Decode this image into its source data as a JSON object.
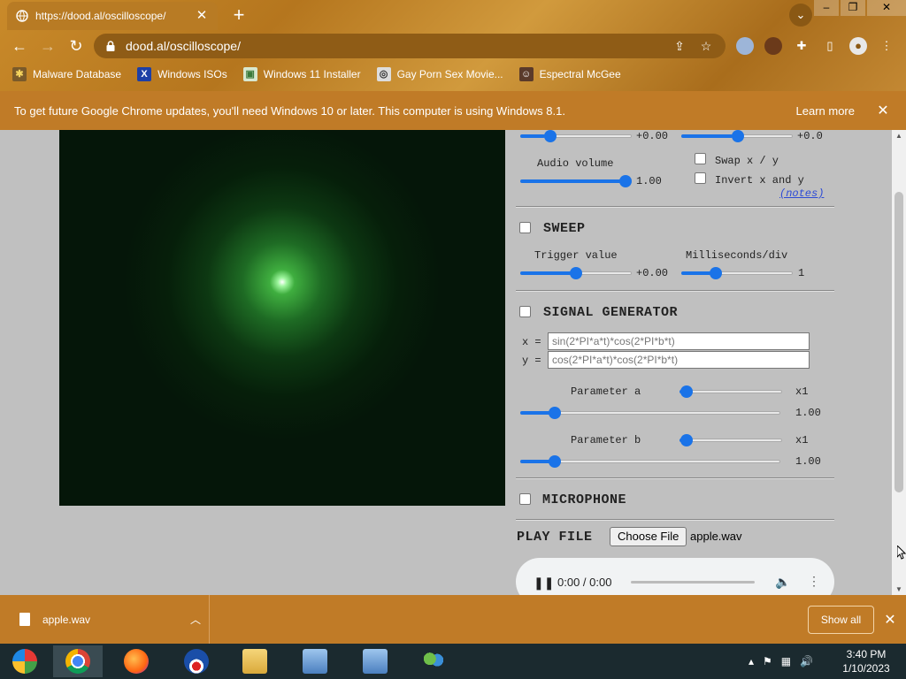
{
  "browser": {
    "tab_title": "https://dood.al/oscilloscope/",
    "url": "dood.al/oscilloscope/",
    "bookmarks": [
      {
        "label": "Malware Database",
        "icon": "bug-icon"
      },
      {
        "label": "Windows ISOs",
        "icon": "x-logo-icon"
      },
      {
        "label": "Windows 11 Installer",
        "icon": "image-icon"
      },
      {
        "label": "Gay Porn Sex Movie...",
        "icon": "globe-icon"
      },
      {
        "label": "Espectral McGee",
        "icon": "person-icon"
      }
    ],
    "infobar": {
      "message": "To get future Google Chrome updates, you'll need Windows 10 or later. This computer is using Windows 8.1.",
      "learn_more": "Learn more"
    }
  },
  "controls": {
    "slider_top_left_value": "+0.00",
    "slider_top_right_value": "+0.0",
    "audio_volume_label": "Audio volume",
    "audio_volume_value": "1.00",
    "swap_label": "Swap x / y",
    "invert_label": "Invert x and y",
    "notes_label": "(notes)",
    "sweep": {
      "title": "SWEEP",
      "trigger_label": "Trigger value",
      "trigger_value": "+0.00",
      "ms_label": "Milliseconds/div",
      "ms_value": "1"
    },
    "signal_generator": {
      "title": "SIGNAL GENERATOR",
      "x_label": "x =",
      "y_label": "y =",
      "x_expr": "sin(2*PI*a*t)*cos(2*PI*b*t)",
      "y_expr": "cos(2*PI*a*t)*cos(2*PI*b*t)",
      "param_a_label": "Parameter a",
      "param_a_mult": "x1",
      "param_a_value": "1.00",
      "param_b_label": "Parameter b",
      "param_b_mult": "x1",
      "param_b_value": "1.00"
    },
    "microphone": {
      "title": "MICROPHONE"
    },
    "play_file": {
      "title": "PLAY FILE",
      "choose_file": "Choose File",
      "file_name": "apple.wav"
    },
    "audio_player": {
      "time": "0:00 / 0:00"
    }
  },
  "download_bar": {
    "file_name": "apple.wav",
    "show_all": "Show all"
  },
  "taskbar": {
    "time": "3:40 PM",
    "date": "1/10/2023"
  },
  "colors": {
    "accent": "#1a73e8",
    "chrome_frame": "#c07b27",
    "scope_glow": "#3fae3f"
  }
}
